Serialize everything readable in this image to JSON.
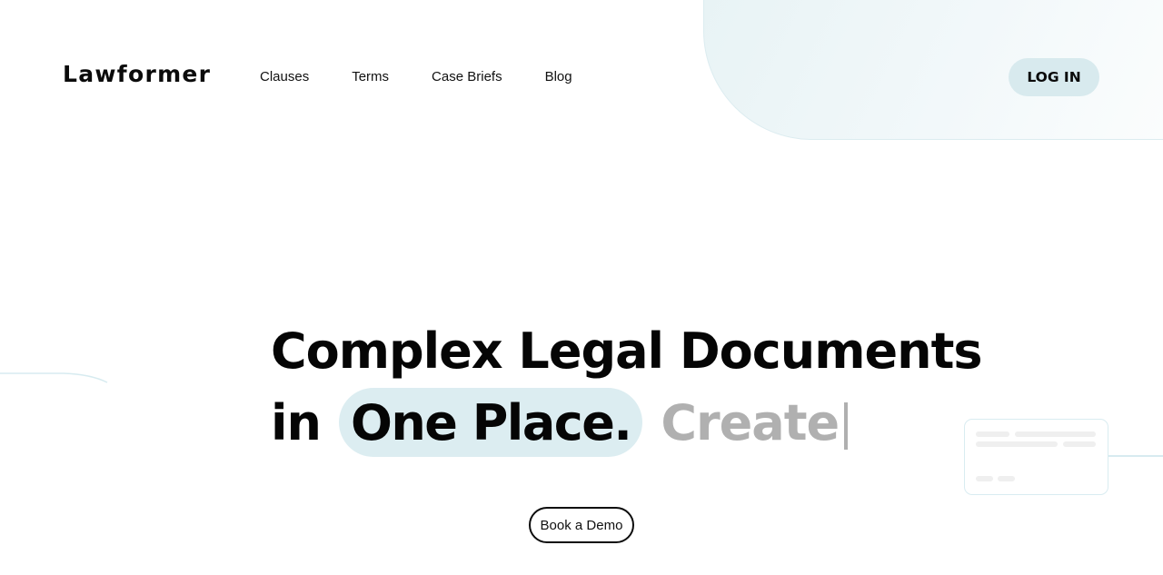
{
  "brand": {
    "logo_text": "Lawformer"
  },
  "nav": {
    "items": [
      {
        "label": "Clauses"
      },
      {
        "label": "Terms"
      },
      {
        "label": "Case Briefs"
      },
      {
        "label": "Blog"
      }
    ],
    "login_label": "LOG IN"
  },
  "hero": {
    "headline_line1": "Complex Legal Documents",
    "headline_line2_prefix": "in",
    "headline_highlight": "One Place.",
    "typed_word": "Create",
    "cta_label": "Book a Demo"
  },
  "colors": {
    "accent_highlight": "#dcedf1",
    "login_bg": "#d8eaee",
    "typed_text": "#b0b0b0",
    "text_primary": "#050505"
  }
}
